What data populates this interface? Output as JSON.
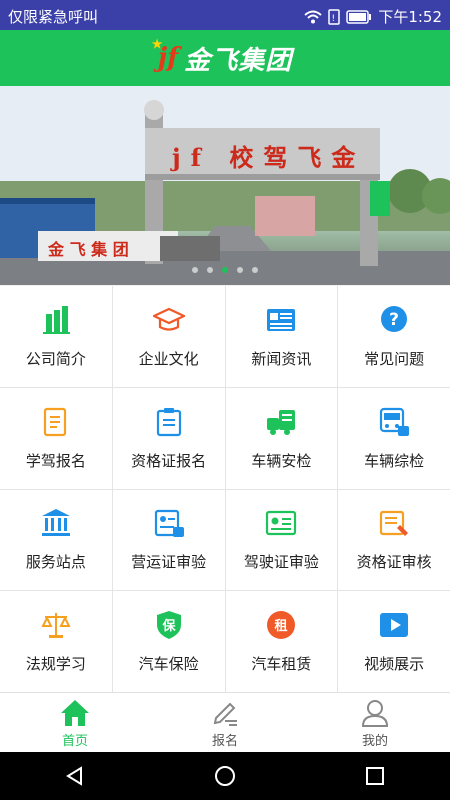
{
  "status_bar": {
    "carrier_text": "仅限紧急呼叫",
    "time": "下午1:52",
    "icons": [
      "wifi-icon",
      "signal-icon",
      "battery-icon"
    ]
  },
  "header": {
    "logo_text": "jf",
    "title": "金飞集团"
  },
  "banner": {
    "gate_sign": "jf 校驾飞金",
    "wall_sign": "金 飞 集 团",
    "dots": 5,
    "active_dot": 2
  },
  "grid": {
    "items": [
      {
        "label": "公司简介",
        "icon": "building-icon",
        "color": "#1ec25a"
      },
      {
        "label": "企业文化",
        "icon": "graduation-cap-icon",
        "color": "#f05a28"
      },
      {
        "label": "新闻资讯",
        "icon": "newspaper-icon",
        "color": "#1e90e8"
      },
      {
        "label": "常见问题",
        "icon": "question-icon",
        "color": "#1e90e8"
      },
      {
        "label": "学驾报名",
        "icon": "edit-form-icon",
        "color": "#f5a020"
      },
      {
        "label": "资格证报名",
        "icon": "clipboard-icon",
        "color": "#1e90e8"
      },
      {
        "label": "车辆安检",
        "icon": "truck-check-icon",
        "color": "#1ec25a"
      },
      {
        "label": "车辆综检",
        "icon": "bus-check-icon",
        "color": "#1e90e8"
      },
      {
        "label": "服务站点",
        "icon": "bank-icon",
        "color": "#1e90e8"
      },
      {
        "label": "营运证审验",
        "icon": "id-card-badge-icon",
        "color": "#1e90e8"
      },
      {
        "label": "驾驶证审验",
        "icon": "id-card-icon",
        "color": "#1ec25a"
      },
      {
        "label": "资格证审核",
        "icon": "certificate-pen-icon",
        "color": "#f5a020"
      },
      {
        "label": "法规学习",
        "icon": "scales-icon",
        "color": "#f5a020"
      },
      {
        "label": "汽车保险",
        "icon": "shield-icon",
        "color": "#1ec25a",
        "glyph": "保"
      },
      {
        "label": "汽车租赁",
        "icon": "rent-icon",
        "color": "#f05a28",
        "glyph": "租"
      },
      {
        "label": "视频展示",
        "icon": "play-icon",
        "color": "#1e90e8"
      }
    ]
  },
  "tabbar": {
    "tabs": [
      {
        "label": "首页",
        "icon": "home-icon",
        "active": true
      },
      {
        "label": "报名",
        "icon": "pen-icon",
        "active": false
      },
      {
        "label": "我的",
        "icon": "user-icon",
        "active": false
      }
    ]
  },
  "colors": {
    "status_bar": "#3b3fa8",
    "primary_green": "#1ec25a",
    "grid_divider": "#e4e4e4"
  }
}
